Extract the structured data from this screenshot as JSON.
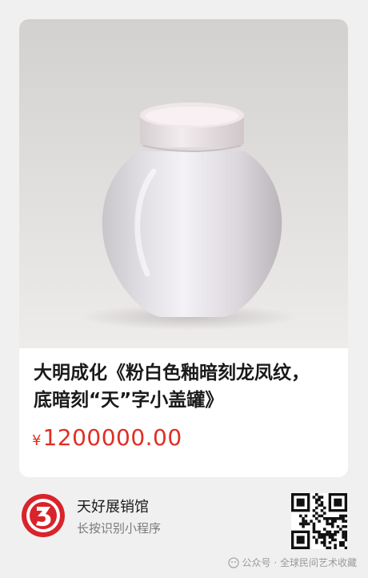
{
  "product": {
    "image_icon": "porcelain-covered-jar-photo",
    "title": "大明成化《粉白色釉暗刻龙凤纹，底暗刻“天”字小盖罐》",
    "currency_symbol": "¥",
    "price": "1200000.00"
  },
  "shop": {
    "logo_icon": "red-3-logo",
    "name": "天好展销馆",
    "hint": "长按识别小程序",
    "qr_icon": "qr-code"
  },
  "watermark": {
    "icon": "wechat-official-account-icon",
    "text": "公众号 · 全球民间艺术收藏"
  },
  "colors": {
    "price": "#e02e24",
    "logo_red": "#d8242a",
    "background": "#f0f0f0"
  }
}
